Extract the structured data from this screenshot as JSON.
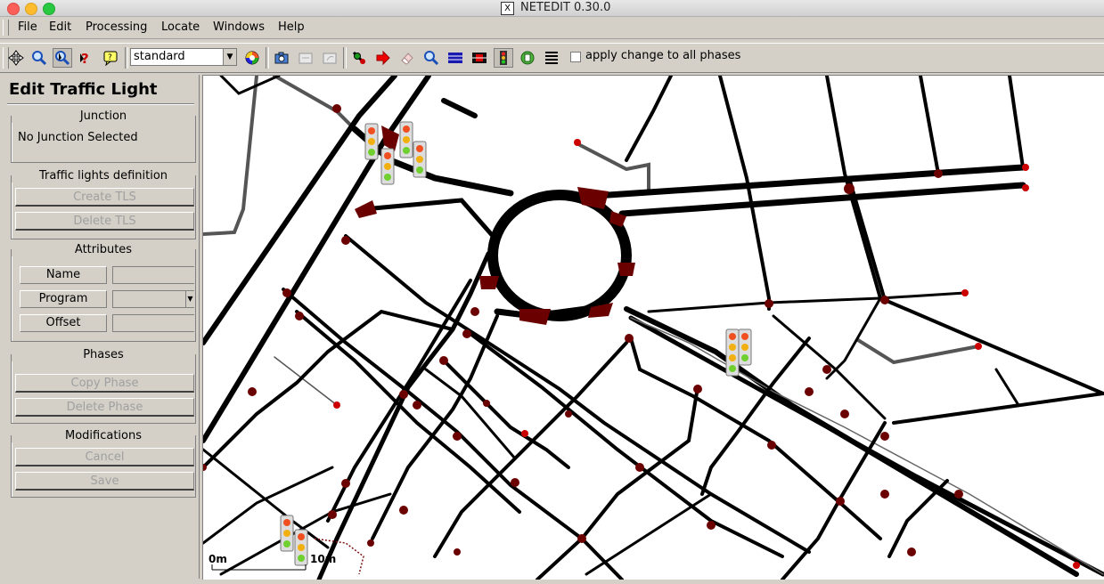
{
  "window": {
    "title": "NETEDIT 0.30.0"
  },
  "menu": [
    "File",
    "Edit",
    "Processing",
    "Locate",
    "Windows",
    "Help"
  ],
  "toolbar": {
    "scheme_value": "standard",
    "apply_all_label": "apply change to all phases",
    "apply_all_checked": false
  },
  "panel": {
    "title": "Edit Traffic Light",
    "junction": {
      "heading": "Junction",
      "status": "No Junction Selected"
    },
    "tls_definition": {
      "heading": "Traffic lights definition",
      "create": "Create TLS",
      "delete": "Delete TLS"
    },
    "attributes": {
      "heading": "Attributes",
      "name": "Name",
      "program": "Program",
      "offset": "Offset"
    },
    "phases": {
      "heading": "Phases",
      "copy": "Copy Phase",
      "delete": "Delete Phase"
    },
    "modifications": {
      "heading": "Modifications",
      "cancel": "Cancel",
      "save": "Save"
    }
  },
  "canvas": {
    "scale_start": "0m",
    "scale_end": "10m"
  },
  "colors": {
    "road": "#000000",
    "junction": "#6b0000",
    "background": "#ffffff",
    "panel": "#d4d0c8"
  }
}
